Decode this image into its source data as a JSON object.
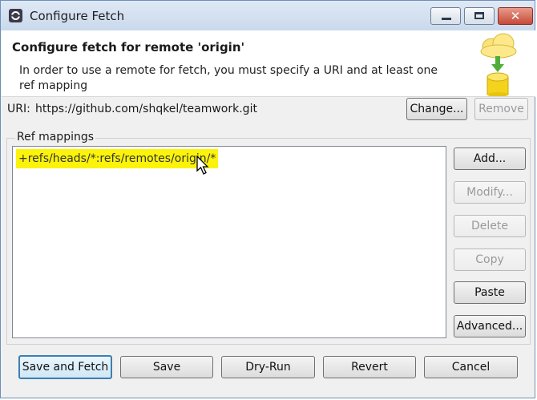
{
  "window": {
    "title": "Configure Fetch",
    "minimize_icon": "minimize-icon",
    "maximize_icon": "maximize-icon",
    "close_glyph": "✕"
  },
  "header": {
    "title": "Configure fetch for remote 'origin'",
    "message": "In order to use a remote for fetch, you must specify a URI and at least one ref mapping",
    "image_icon": "cloud-fetch-database-icon"
  },
  "uri": {
    "label": "URI:",
    "value": "https://github.com/shqkel/teamwork.git",
    "change_label": "Change...",
    "remove_label": "Remove"
  },
  "ref_mappings": {
    "group_label": "Ref mappings",
    "items": [
      "+refs/heads/*:refs/remotes/origin/*"
    ],
    "highlight_color": "#fcf30a",
    "buttons": {
      "add": "Add...",
      "modify": "Modify...",
      "delete": "Delete",
      "copy": "Copy",
      "paste": "Paste",
      "advanced": "Advanced..."
    }
  },
  "footer": {
    "save_and_fetch": "Save and Fetch",
    "save": "Save",
    "dry_run": "Dry-Run",
    "revert": "Revert",
    "cancel": "Cancel"
  }
}
